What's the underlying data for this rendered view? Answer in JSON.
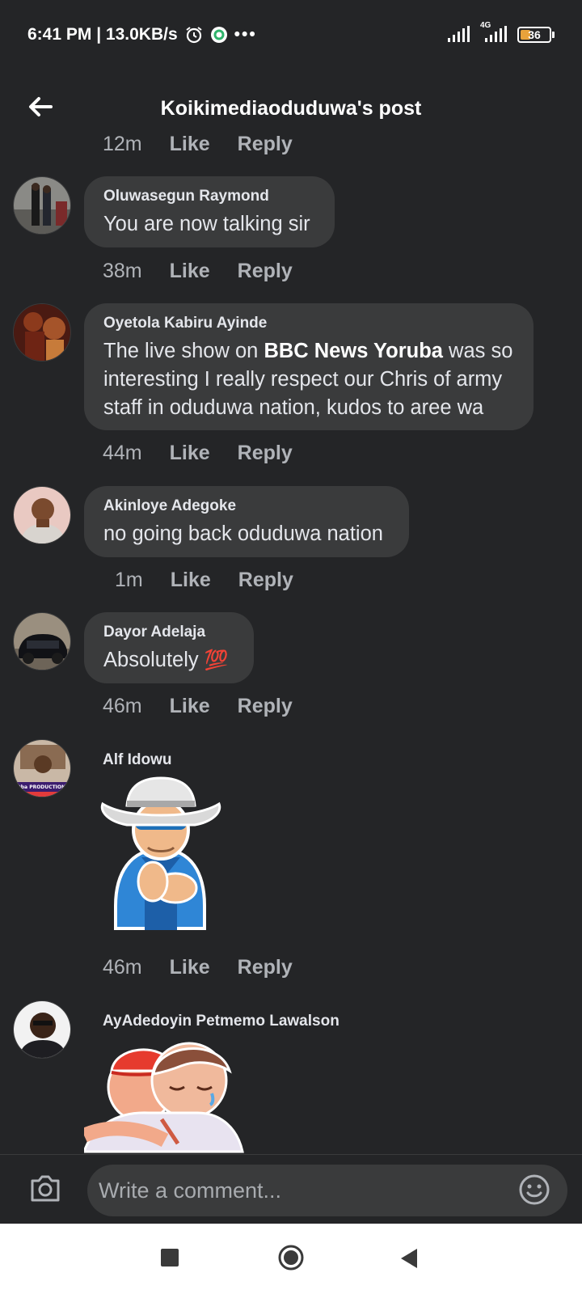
{
  "status_bar": {
    "time_speed": "6:41 PM | 13.0KB/s",
    "more": "•••",
    "network": "4G",
    "battery": "36",
    "battery_color": "#e9a23b"
  },
  "header": {
    "title": "Koikimediaoduduwa's post",
    "back_icon": "arrow-left-icon"
  },
  "actions": {
    "like": "Like",
    "reply": "Reply"
  },
  "top_meta": {
    "time": "12m"
  },
  "comments": [
    {
      "author": "Oluwasegun Raymond",
      "text": "You are now talking sir",
      "time": "38m"
    },
    {
      "author": "Oyetola Kabiru Ayinde",
      "text_before": "The live show on ",
      "text_bold": "BBC News Yoruba",
      "text_after": " was so interesting I really respect our Chris of army staff in oduduwa nation, kudos to aree wa",
      "time": "44m"
    },
    {
      "author": "Akinloye Adegoke",
      "text": "no going back oduduwa nation",
      "time": "1m"
    },
    {
      "author": "Dayor Adelaja",
      "text": "Absolutely",
      "emoji": "💯",
      "time": "46m"
    },
    {
      "author": "Alf Idowu",
      "sticker": "cowboy-clapping-sticker",
      "time": "46m",
      "avatar_caption": "Oba PRODUCTIONS"
    },
    {
      "author": "AyAdedoyin Petmemo Lawalson",
      "sticker": "hug-sticker"
    }
  ],
  "composer": {
    "placeholder": "Write a comment...",
    "camera_icon": "camera-icon",
    "emoji_icon": "smiley-icon"
  },
  "accent_colors": {
    "background": "#242527",
    "bubble": "#3a3b3c",
    "meta_text": "#b0b3b8"
  }
}
